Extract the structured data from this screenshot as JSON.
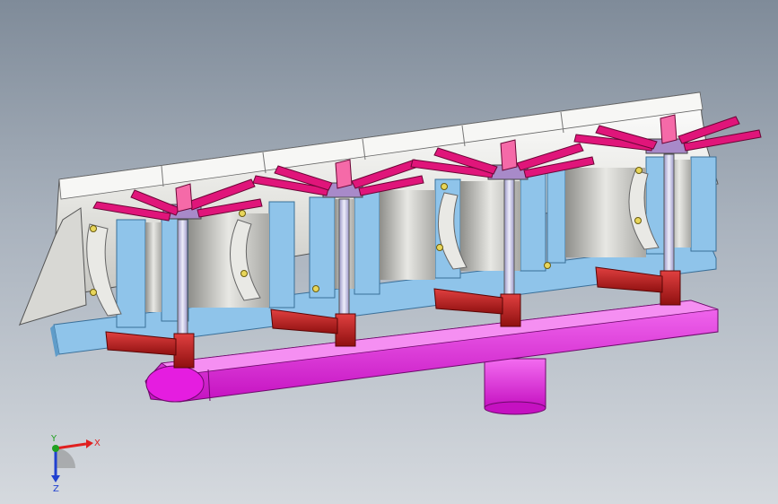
{
  "viewport": {
    "background_top": "#7f8b99",
    "background_bottom": "#d5d9de"
  },
  "model": {
    "colors": {
      "trim_panel": "#f4f4f0",
      "trim_panel_shade": "#c9c9c4",
      "fixture_frame": "#8fc4ea",
      "fixture_frame_dark": "#5f9cc9",
      "clamp_arms": "#e0157a",
      "clamp_arms_light": "#f56aa8",
      "support_columns": "#c9c6e6",
      "pivot_arms": "#b11a1a",
      "pivot_arms_light": "#e04040",
      "base_beam": "#e51de0",
      "base_beam_dark": "#a910a6",
      "fasteners": "#e8d65a"
    },
    "clamp_station_count": 4
  },
  "triad": {
    "x_label": "X",
    "y_label": "Y",
    "z_label": "Z",
    "x_color": "#e02020",
    "y_color": "#20a020",
    "z_color": "#2040d0"
  }
}
